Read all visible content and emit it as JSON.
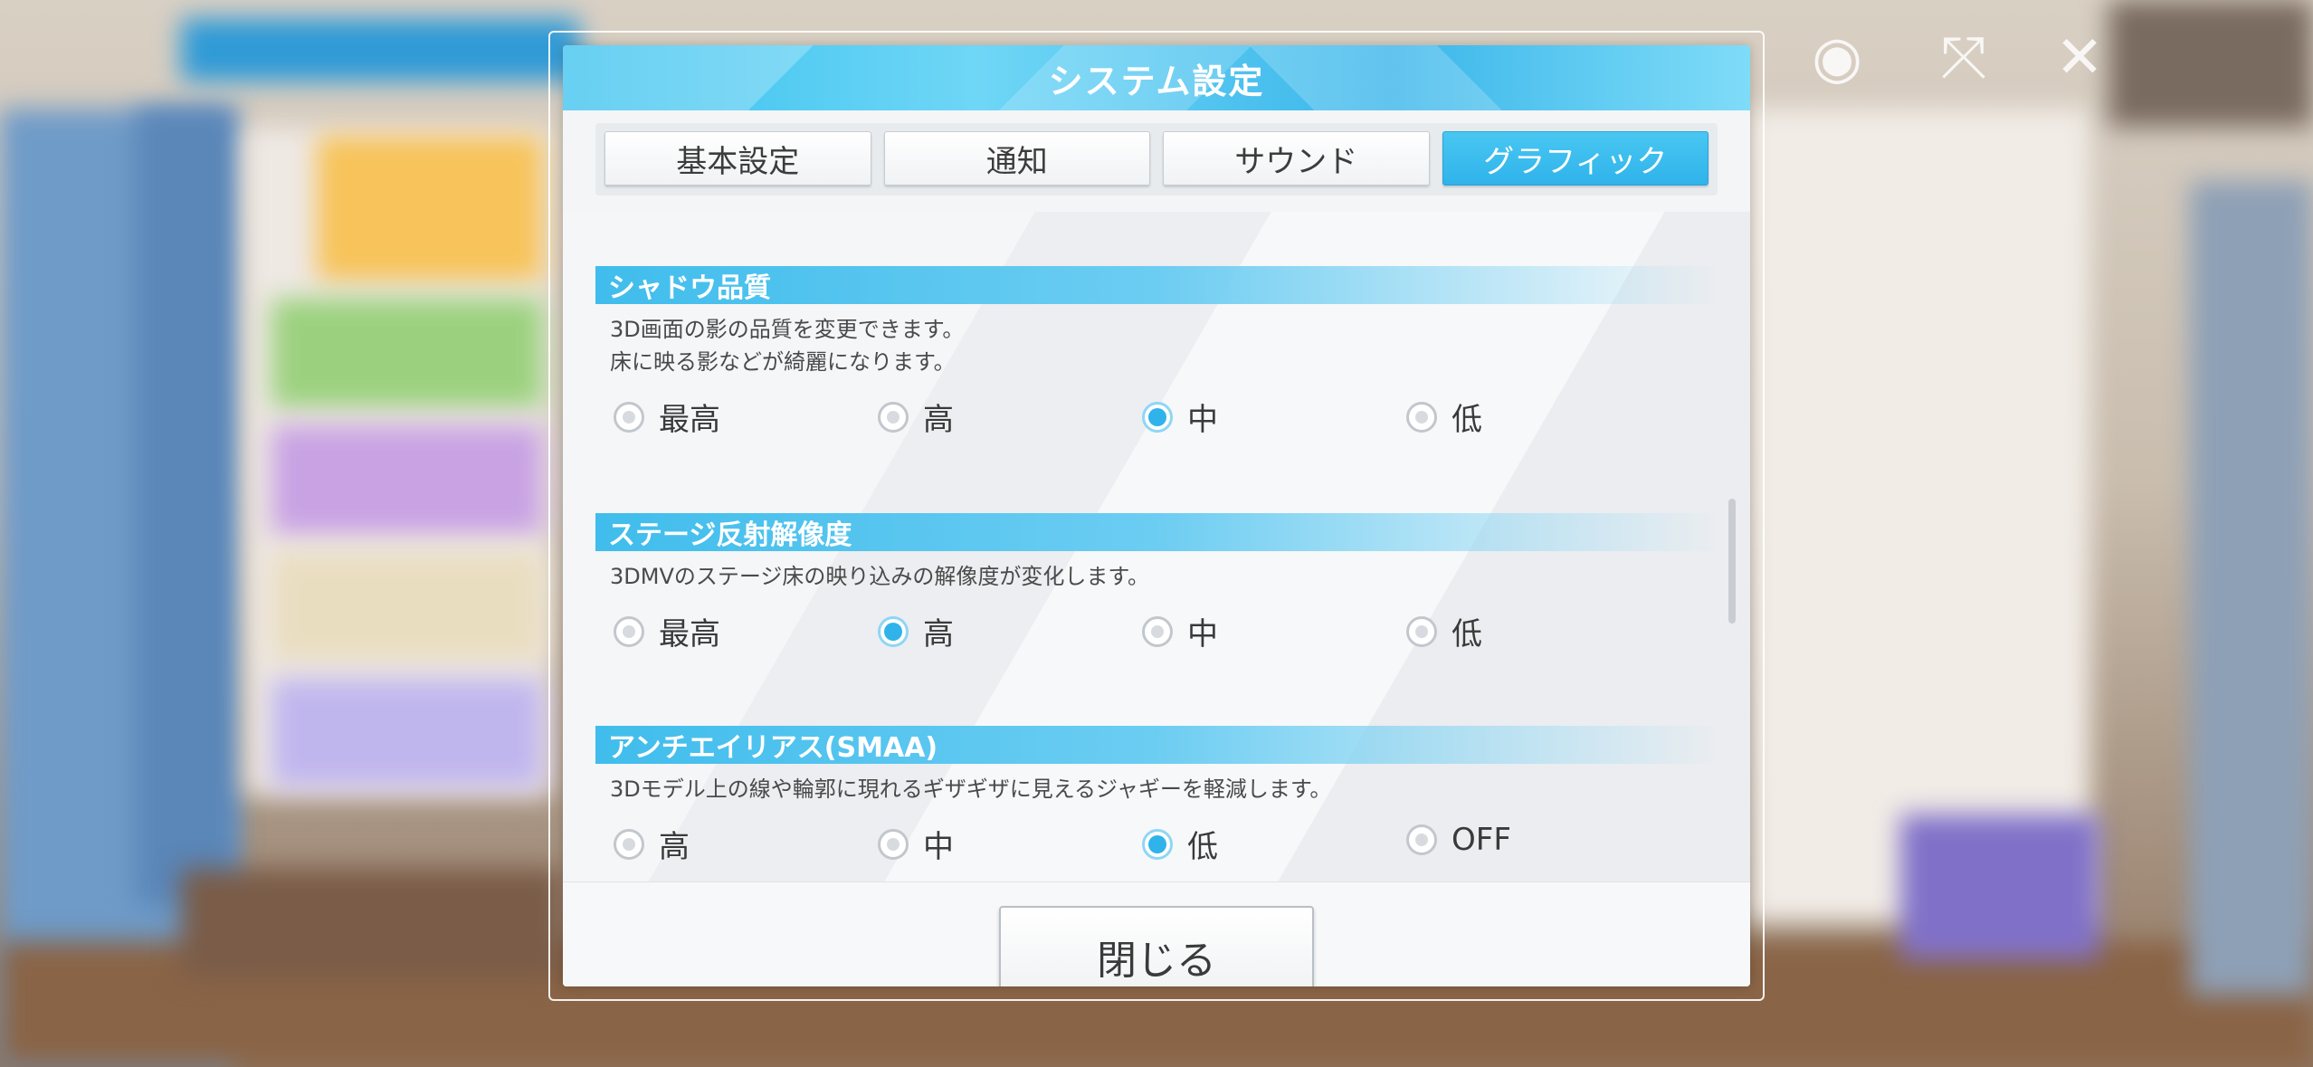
{
  "dialog": {
    "title": "システム設定",
    "close_label": "閉じる"
  },
  "tabs": [
    {
      "label": "基本設定",
      "active": false
    },
    {
      "label": "通知",
      "active": false
    },
    {
      "label": "サウンド",
      "active": false
    },
    {
      "label": "グラフィック",
      "active": true
    }
  ],
  "sections": [
    {
      "title": "シャドウ品質",
      "description": "3D画面の影の品質を変更できます。\n床に映る影などが綺麗になります。",
      "options": [
        {
          "label": "最高",
          "selected": false
        },
        {
          "label": "高",
          "selected": false
        },
        {
          "label": "中",
          "selected": true
        },
        {
          "label": "低",
          "selected": false
        }
      ]
    },
    {
      "title": "ステージ反射解像度",
      "description": "3DMVのステージ床の映り込みの解像度が変化します。",
      "options": [
        {
          "label": "最高",
          "selected": false
        },
        {
          "label": "高",
          "selected": true
        },
        {
          "label": "中",
          "selected": false
        },
        {
          "label": "低",
          "selected": false
        }
      ]
    },
    {
      "title": "アンチエイリアス(SMAA)",
      "description": "3Dモデル上の線や輪郭に現れるギザギザに見えるジャギーを軽減します。",
      "options": [
        {
          "label": "高",
          "selected": false
        },
        {
          "label": "中",
          "selected": false
        },
        {
          "label": "低",
          "selected": true
        },
        {
          "label": "OFF",
          "selected": false
        }
      ]
    }
  ],
  "hud_icons": [
    "menu-icon",
    "fullscreen-icon",
    "close-icon"
  ],
  "colors": {
    "accent": "#2fb3ea",
    "header": "#35c0ee"
  }
}
